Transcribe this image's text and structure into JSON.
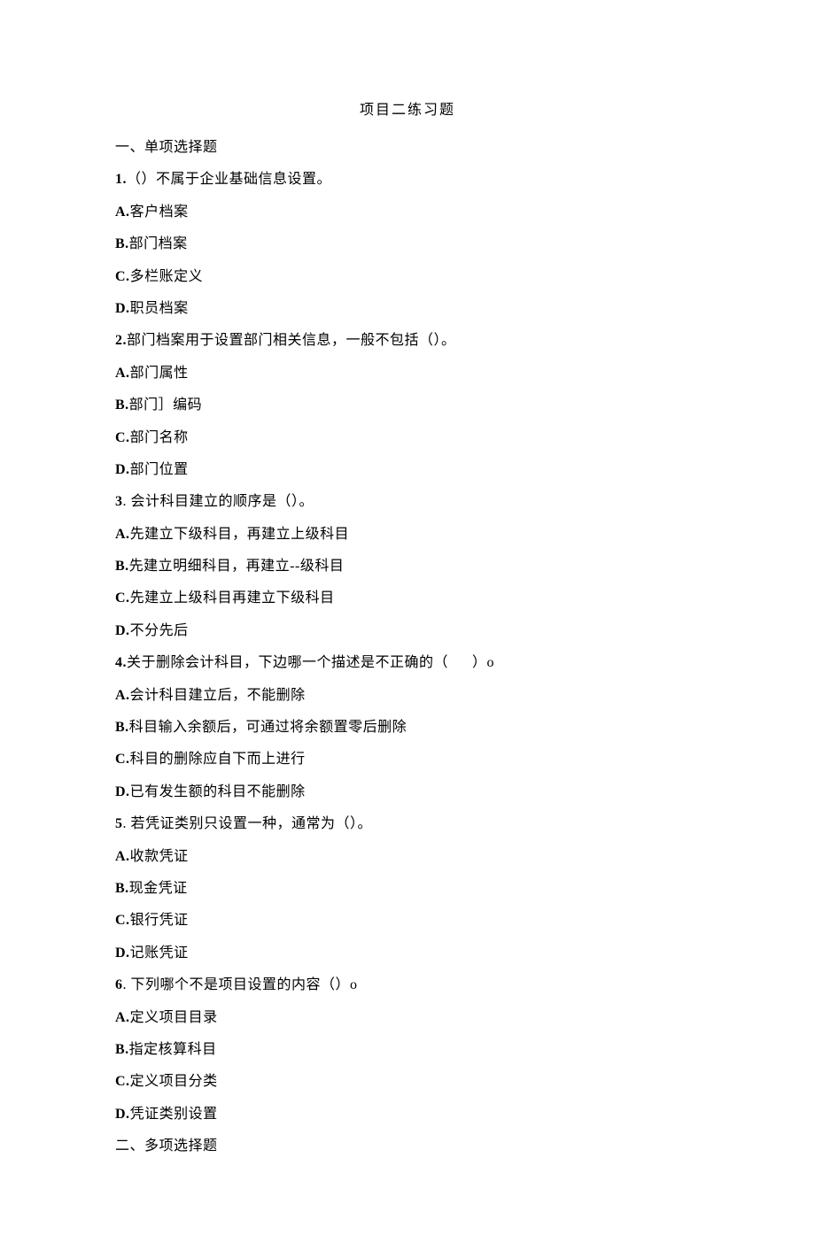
{
  "title": "项目二练习题",
  "sections": {
    "s1_heading": "一、单项选择题",
    "q1": {
      "stem_prefix": "1.",
      "stem": "（）不属于企业基础信息设置。",
      "a": "客户档案",
      "b": "部门档案",
      "c": "多栏账定义",
      "d": "职员档案"
    },
    "q2": {
      "stem_prefix": "2.",
      "stem": "部门档案用于设置部门相关信息，一般不包括（）。",
      "a": "部门属性",
      "b_prefix": "B.",
      "b_text": "部门］编码",
      "c": "部门名称",
      "d": "部门位置"
    },
    "q3": {
      "stem_prefix": "3",
      "stem": ". 会计科目建立的顺序是（）。",
      "a": "先建立下级科目，再建立上级科目",
      "b": "先建立明细科目，再建立--级科目",
      "c": "先建立上级科目再建立下级科目",
      "d": "不分先后"
    },
    "q4": {
      "stem_prefix": "4.",
      "stem_part1": "关于删除会计科目，下边哪一个描述是不正确的（",
      "stem_part2": "）o",
      "a": "会计科目建立后，不能删除",
      "b": "科目输入余额后，可通过将余额置零后删除",
      "c": "科目的删除应自下而上进行",
      "d": "已有发生额的科目不能删除"
    },
    "q5": {
      "stem_prefix": "5",
      "stem": ". 若凭证类别只设置一种，通常为（）。",
      "a": "收款凭证",
      "b": "现金凭证",
      "c": "银行凭证",
      "d": "记账凭证"
    },
    "q6": {
      "stem_prefix": "6",
      "stem": ". 下列哪个不是项目设置的内容（）o",
      "a": "定义项目目录",
      "b": "指定核算科目",
      "c": "定义项目分类",
      "d": "凭证类别设置"
    },
    "s2_heading": "二、多项选择题"
  },
  "labels": {
    "A": "A.",
    "B": "B.",
    "C": "C.",
    "D": "D."
  }
}
